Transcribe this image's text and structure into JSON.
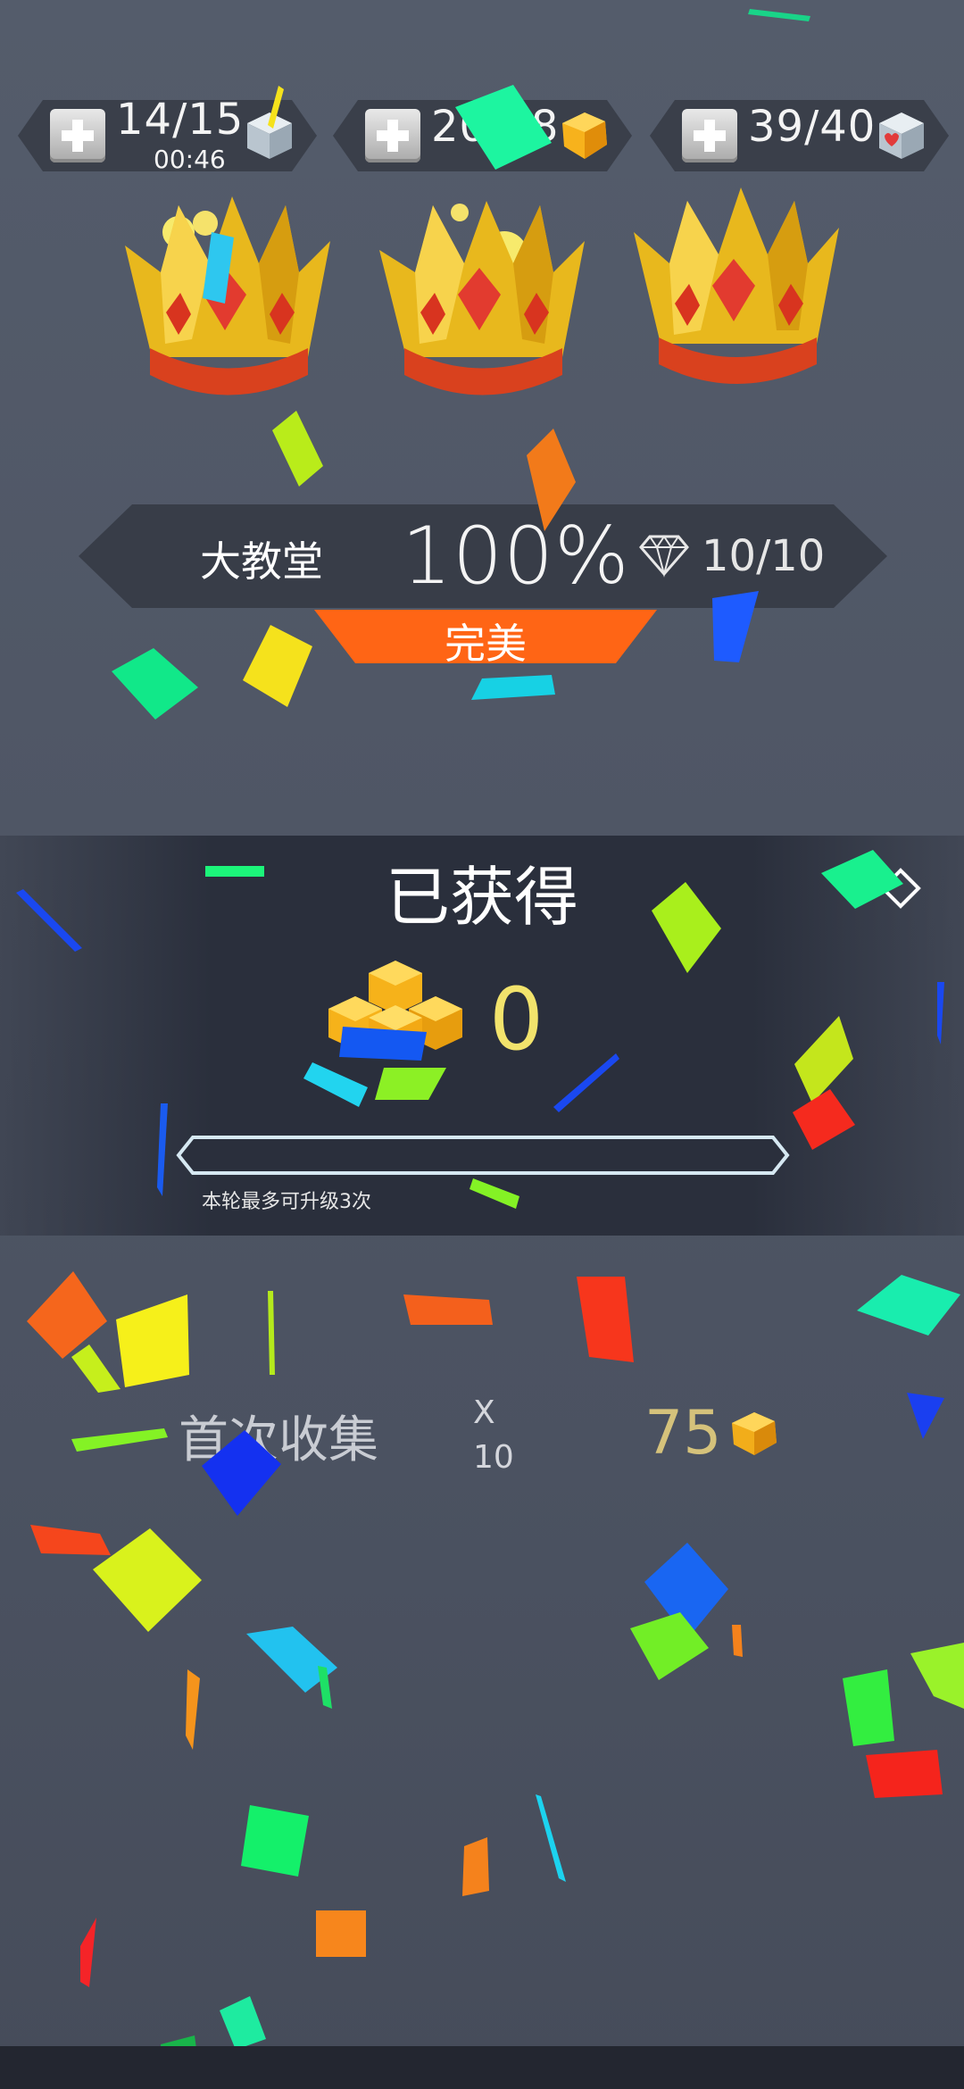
{
  "resources": {
    "energy": {
      "value": "14/15",
      "timer": "00:46",
      "icon": "grey-cube-icon"
    },
    "gold": {
      "value": "20...8",
      "icon": "gold-cube-icon"
    },
    "hearts": {
      "value": "39/40",
      "icon": "heart-cube-icon"
    }
  },
  "crowns": {
    "count": 3,
    "icon": "crown-icon"
  },
  "level": {
    "name": "大教堂",
    "percent": "100%",
    "gems": "10/10",
    "rating": "完美"
  },
  "reward": {
    "title": "已获得",
    "amount": "0",
    "upgrade_note": "本轮最多可升级3次",
    "progress": 0
  },
  "first_collect": {
    "label": "首次收集",
    "multiplier_symbol": "X",
    "multiplier": "10",
    "amount": "75"
  },
  "colors": {
    "accent_orange": "#ff6515",
    "gold_text": "#f2e36c",
    "panel": "#2a2f3c",
    "background": "#4f5665"
  }
}
